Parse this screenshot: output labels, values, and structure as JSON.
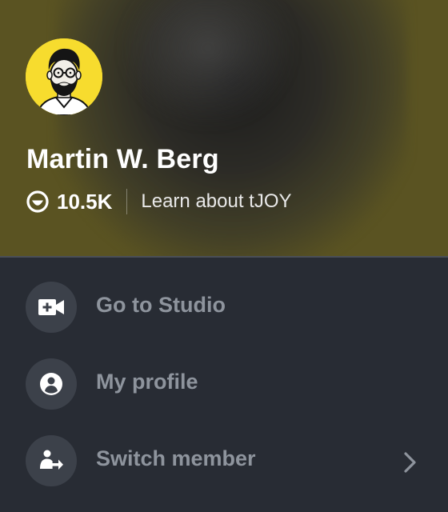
{
  "profile": {
    "name": "Martin W. Berg",
    "points": "10.5K",
    "learn_link": "Learn about tJOY"
  },
  "menu": {
    "items": [
      {
        "label": "Go to Studio",
        "icon": "video-plus-icon"
      },
      {
        "label": "My profile",
        "icon": "account-circle-icon"
      },
      {
        "label": "Switch member",
        "icon": "switch-member-icon",
        "has_chevron": true
      }
    ]
  },
  "colors": {
    "header_bg": "#5a5322",
    "menu_bg": "#282c34",
    "icon_circle_bg": "#3c414a",
    "menu_text": "#8e949d",
    "avatar_bg": "#f7dc2e"
  }
}
